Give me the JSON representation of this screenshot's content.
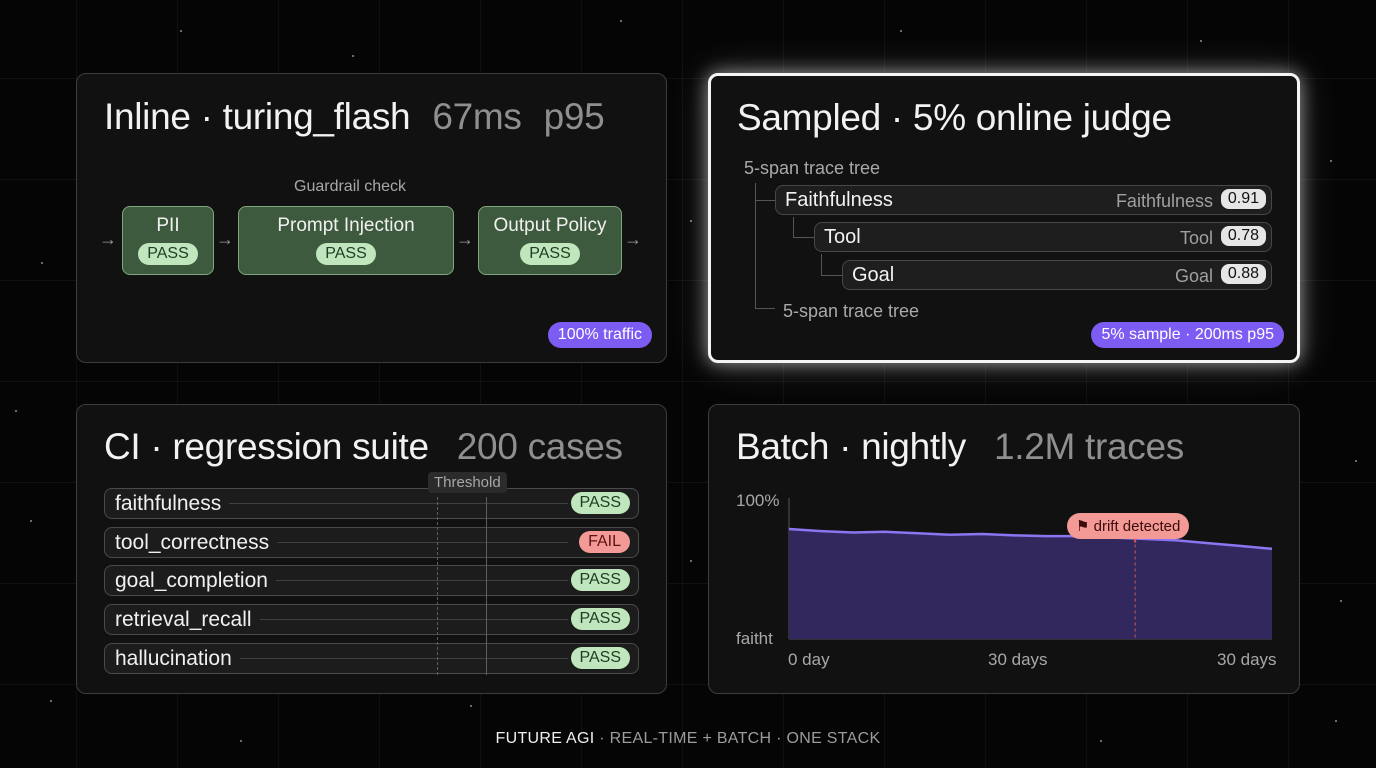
{
  "inline_panel": {
    "title_main": "Inline · turing_flash",
    "latency": "67ms",
    "percentile": "p95",
    "guardrail_label": "Guardrail check",
    "stages": [
      {
        "name": "PII",
        "status": "PASS"
      },
      {
        "name": "Prompt Injection",
        "status": "PASS"
      },
      {
        "name": "Output Policy",
        "status": "PASS"
      }
    ],
    "traffic_pill": "100% traffic"
  },
  "sampled_panel": {
    "title": "Sampled · 5% online judge",
    "tree_label_top": "5-span trace tree",
    "tree_label_bottom": "5-span trace tree",
    "rows": [
      {
        "name": "Faithfulness",
        "metric": "Faithfulness",
        "score": "0.91"
      },
      {
        "name": "Tool",
        "metric": "Tool",
        "score": "0.78"
      },
      {
        "name": "Goal",
        "metric": "Goal",
        "score": "0.88"
      }
    ],
    "sample_pill": "5% sample · 200ms p95"
  },
  "ci_panel": {
    "title_main": "CI · regression suite",
    "cases": "200 cases",
    "threshold_label": "Threshold",
    "rows": [
      {
        "name": "faithfulness",
        "status": "PASS"
      },
      {
        "name": "tool_correctness",
        "status": "FAIL"
      },
      {
        "name": "goal_completion",
        "status": "PASS"
      },
      {
        "name": "retrieval_recall",
        "status": "PASS"
      },
      {
        "name": "hallucination",
        "status": "PASS"
      }
    ]
  },
  "batch_panel": {
    "title_main": "Batch · nightly",
    "traces": "1.2M traces",
    "drift_label": "drift detected"
  },
  "chart_data": {
    "type": "area",
    "title": "",
    "y_top_label": "100%",
    "ylabel": "faitht",
    "x_tick_labels": [
      "0 day",
      "30 days",
      "30 days"
    ],
    "x": [
      0,
      2,
      4,
      6,
      8,
      10,
      12,
      14,
      16,
      18,
      20,
      22,
      24,
      26,
      28,
      30
    ],
    "values": [
      0.78,
      0.765,
      0.755,
      0.76,
      0.75,
      0.74,
      0.745,
      0.735,
      0.73,
      0.73,
      0.72,
      0.71,
      0.7,
      0.68,
      0.66,
      0.64
    ],
    "xlim": [
      0,
      30
    ],
    "ylim": [
      0,
      1
    ],
    "drift_x": 21.5,
    "line_color": "#8b75f0",
    "fill_color": "#33285e",
    "grid": false
  },
  "footer": {
    "brand": "FUTURE AGI",
    "tagline": " · REAL-TIME + BATCH · ONE STACK"
  },
  "colors": {
    "accent_purple": "#7c5cf2",
    "pass_green": "#bfe6bd",
    "fail_red": "#f39a96"
  }
}
